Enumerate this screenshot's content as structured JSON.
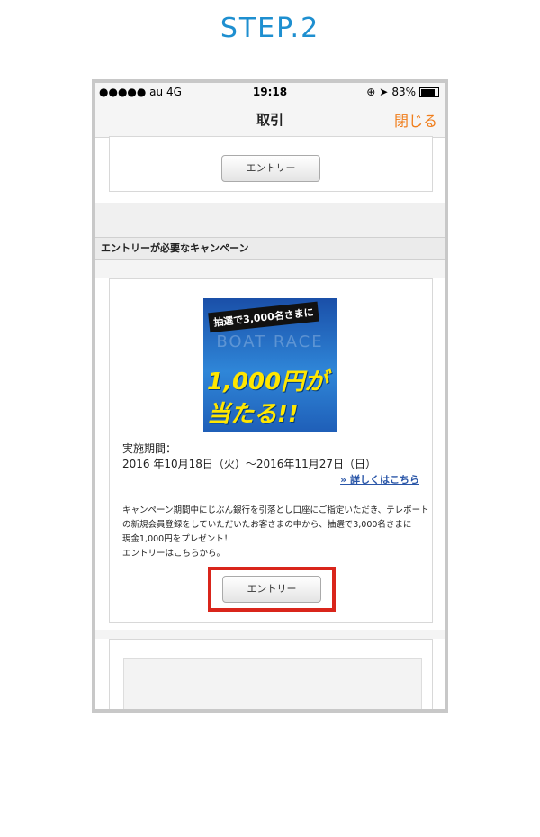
{
  "step_title": "STEP.2",
  "status_bar": {
    "carrier": "●●●●● au  4G",
    "time": "19:18",
    "battery": "83%"
  },
  "nav": {
    "title": "取引",
    "close_label": "閉じる"
  },
  "entry_button_label": "エントリー",
  "section_header": "エントリーが必要なキャンペーン",
  "banner": {
    "tag": "抽選で3,000名さまに",
    "faint": "BOAT RACE",
    "amount": "1,000円が",
    "hit": "当たる!!"
  },
  "campaign": {
    "period_label": "実施期間：",
    "period_dates": "2016 年10月18日（火）～2016年11月27日（日）",
    "details_link": "» 詳しくはこちら",
    "description_lines": [
      "キャンペーン期間中にじぶん銀行を引落とし口座にご指定いただき、テレボート",
      "の新規会員登録をしていただいたお客さまの中から、抽選で3,000名さまに",
      "現金1,000円をプレゼント！",
      "エントリーはこちらから。"
    ]
  }
}
